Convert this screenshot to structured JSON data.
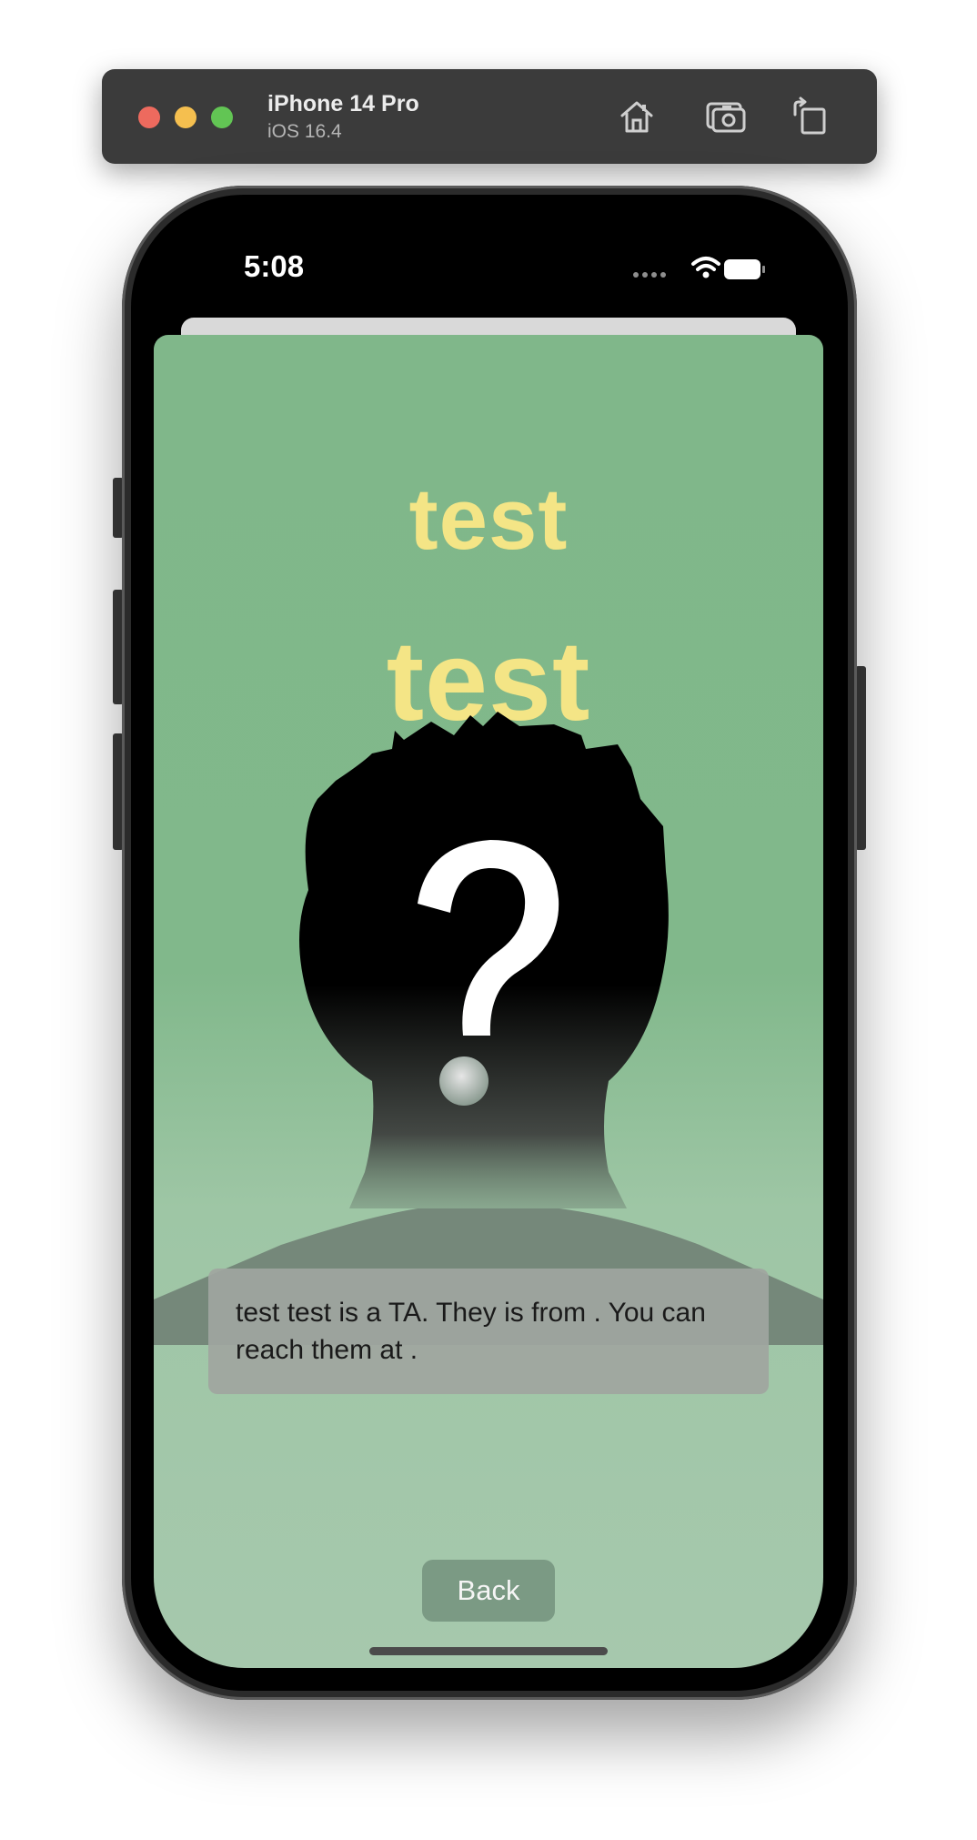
{
  "simulator": {
    "device_name": "iPhone 14 Pro",
    "os_version": "iOS 16.4",
    "icons": [
      "home-icon",
      "screenshot-icon",
      "rotate-icon"
    ]
  },
  "status_bar": {
    "time": "5:08",
    "icons": [
      "cellular-dots-icon",
      "wifi-icon",
      "battery-icon"
    ]
  },
  "profile": {
    "first_name": "test",
    "last_name": "test",
    "bio": "test test is a TA. They is from . You can reach them at .",
    "avatar": "unknown-person-question-mark",
    "colors": {
      "background": "#80b78a",
      "name_text": "#f4e586"
    }
  },
  "actions": {
    "back_label": "Back"
  }
}
